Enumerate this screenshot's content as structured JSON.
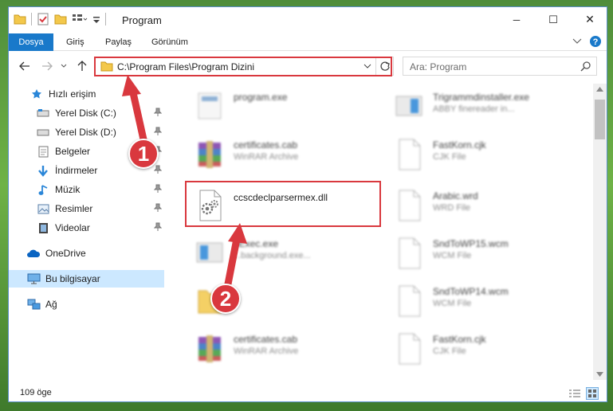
{
  "window": {
    "title": "Program",
    "minimize": "─",
    "maximize": "☐",
    "close": "✕"
  },
  "ribbon": {
    "tabs": [
      "Dosya",
      "Giriş",
      "Paylaş",
      "Görünüm"
    ]
  },
  "nav": {
    "address": "C:\\Program Files\\Program Dizini",
    "search_placeholder": "Ara: Program"
  },
  "sidebar": {
    "items": [
      {
        "label": "Hızlı erişim",
        "icon": "star-icon"
      },
      {
        "label": "Yerel Disk (C:)",
        "icon": "drive-icon"
      },
      {
        "label": "Yerel Disk (D:)",
        "icon": "drive-icon"
      },
      {
        "label": "Belgeler",
        "icon": "documents-icon"
      },
      {
        "label": "İndirmeler",
        "icon": "download-icon"
      },
      {
        "label": "Müzik",
        "icon": "music-icon"
      },
      {
        "label": "Resimler",
        "icon": "pictures-icon"
      },
      {
        "label": "Videolar",
        "icon": "video-icon"
      },
      {
        "label": "OneDrive",
        "icon": "cloud-icon"
      },
      {
        "label": "Bu bilgisayar",
        "icon": "computer-icon"
      },
      {
        "label": "Ağ",
        "icon": "network-icon"
      }
    ]
  },
  "files": [
    {
      "name": "program.exe",
      "type": ""
    },
    {
      "name": "Trigrammdinstaller.exe",
      "type": "ABBY finereader in..."
    },
    {
      "name": "certificates.cab",
      "type": "WinRAR Archive"
    },
    {
      "name": "FastKorn.cjk",
      "type": "CJK File"
    },
    {
      "name": "ccscdeclparsermex.dll",
      "type": ""
    },
    {
      "name": "Arabic.wrd",
      "type": "WRD File"
    },
    {
      "name": "bExec.exe",
      "type": "...background.exe..."
    },
    {
      "name": "SndToWP15.wcm",
      "type": "WCM File"
    },
    {
      "name": "",
      "type": ""
    },
    {
      "name": "SndToWP14.wcm",
      "type": "WCM File"
    },
    {
      "name": "certificates.cab",
      "type": "WinRAR Archive"
    },
    {
      "name": "FastKorn.cjk",
      "type": "CJK File"
    }
  ],
  "status": {
    "count": "109 öge"
  },
  "annotations": {
    "step1": "1",
    "step2": "2"
  },
  "colors": {
    "accent": "#1979ca",
    "highlight": "#d9383e",
    "selected": "#cce8ff"
  }
}
